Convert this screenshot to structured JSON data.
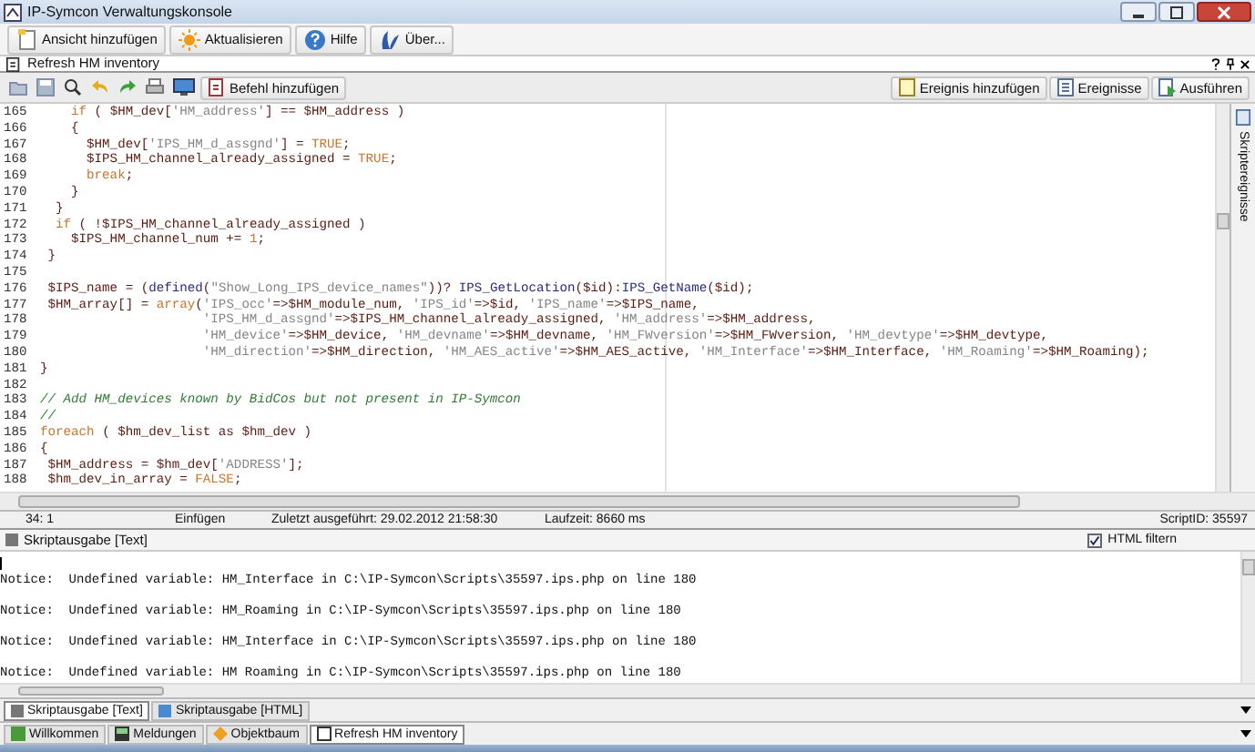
{
  "window": {
    "title": "IP-Symcon Verwaltungskonsole"
  },
  "main_toolbar": [
    {
      "label": "Ansicht hinzufügen"
    },
    {
      "label": "Aktualisieren"
    },
    {
      "label": "Hilfe"
    },
    {
      "label": "Über..."
    }
  ],
  "document": {
    "title": "Refresh HM inventory"
  },
  "script_toolbar": {
    "left_button": "Befehl hinzufügen",
    "right_buttons": [
      {
        "label": "Ereignis hinzufügen"
      },
      {
        "label": "Ereignisse"
      },
      {
        "label": "Ausführen"
      }
    ]
  },
  "editor": {
    "lines": [
      {
        "number": "165",
        "segments": [
          {
            "kind": "kw",
            "text": "    if"
          },
          {
            "kind": "plain",
            "text": " ( $HM_dev["
          },
          {
            "kind": "str",
            "text": "'HM_address'"
          },
          {
            "kind": "plain",
            "text": "] == $HM_address )"
          }
        ]
      },
      {
        "number": "166",
        "segments": [
          {
            "kind": "plain",
            "text": "    {"
          }
        ]
      },
      {
        "number": "167",
        "segments": [
          {
            "kind": "plain",
            "text": "      $HM_dev["
          },
          {
            "kind": "str",
            "text": "'IPS_HM_d_assgnd'"
          },
          {
            "kind": "plain",
            "text": "] = "
          },
          {
            "kind": "kw",
            "text": "TRUE"
          },
          {
            "kind": "plain",
            "text": ";"
          }
        ]
      },
      {
        "number": "168",
        "segments": [
          {
            "kind": "plain",
            "text": "      $IPS_HM_channel_already_assigned = "
          },
          {
            "kind": "kw",
            "text": "TRUE"
          },
          {
            "kind": "plain",
            "text": ";"
          }
        ]
      },
      {
        "number": "169",
        "segments": [
          {
            "kind": "kw",
            "text": "      break"
          },
          {
            "kind": "plain",
            "text": ";"
          }
        ]
      },
      {
        "number": "170",
        "segments": [
          {
            "kind": "plain",
            "text": "    }"
          }
        ]
      },
      {
        "number": "171",
        "segments": [
          {
            "kind": "plain",
            "text": "  }"
          }
        ]
      },
      {
        "number": "172",
        "segments": [
          {
            "kind": "kw",
            "text": "  if"
          },
          {
            "kind": "plain",
            "text": " ( !$IPS_HM_channel_already_assigned )"
          }
        ]
      },
      {
        "number": "173",
        "segments": [
          {
            "kind": "plain",
            "text": "    $IPS_HM_channel_num += "
          },
          {
            "kind": "kw",
            "text": "1"
          },
          {
            "kind": "plain",
            "text": ";"
          }
        ]
      },
      {
        "number": "174",
        "segments": [
          {
            "kind": "plain",
            "text": " }"
          }
        ]
      },
      {
        "number": "175"
      },
      {
        "number": "176",
        "segments": [
          {
            "kind": "plain",
            "text": " $IPS_name = ("
          },
          {
            "kind": "fn",
            "text": "defined"
          },
          {
            "kind": "plain",
            "text": "("
          },
          {
            "kind": "str",
            "text": "\"Show_Long_IPS_device_names\""
          },
          {
            "kind": "plain",
            "text": "))? "
          },
          {
            "kind": "fn",
            "text": "IPS_GetLocation"
          },
          {
            "kind": "plain",
            "text": "($id):"
          },
          {
            "kind": "fn",
            "text": "IPS_GetName"
          },
          {
            "kind": "plain",
            "text": "($id);"
          }
        ]
      },
      {
        "number": "177",
        "segments": [
          {
            "kind": "plain",
            "text": " $HM_array[] = "
          },
          {
            "kind": "kw",
            "text": "array"
          },
          {
            "kind": "plain",
            "text": "("
          },
          {
            "kind": "str",
            "text": "'IPS_occ'"
          },
          {
            "kind": "plain",
            "text": "=>$HM_module_num, "
          },
          {
            "kind": "str",
            "text": "'IPS_id'"
          },
          {
            "kind": "plain",
            "text": "=>$id, "
          },
          {
            "kind": "str",
            "text": "'IPS_name'"
          },
          {
            "kind": "plain",
            "text": "=>$IPS_name,"
          }
        ]
      },
      {
        "number": "178",
        "segments": [
          {
            "kind": "str",
            "text": "                     'IPS_HM_d_assgnd'"
          },
          {
            "kind": "plain",
            "text": "=>$IPS_HM_channel_already_assigned, "
          },
          {
            "kind": "str",
            "text": "'HM_address'"
          },
          {
            "kind": "plain",
            "text": "=>$HM_address,"
          }
        ]
      },
      {
        "number": "179",
        "segments": [
          {
            "kind": "str",
            "text": "                     'HM_device'"
          },
          {
            "kind": "plain",
            "text": "=>$HM_device, "
          },
          {
            "kind": "str",
            "text": "'HM_devname'"
          },
          {
            "kind": "plain",
            "text": "=>$HM_devname, "
          },
          {
            "kind": "str",
            "text": "'HM_FWversion'"
          },
          {
            "kind": "plain",
            "text": "=>$HM_FWversion, "
          },
          {
            "kind": "str",
            "text": "'HM_devtype'"
          },
          {
            "kind": "plain",
            "text": "=>$HM_devtype,"
          }
        ]
      },
      {
        "number": "180",
        "segments": [
          {
            "kind": "str",
            "text": "                     'HM_direction'"
          },
          {
            "kind": "plain",
            "text": "=>$HM_direction, "
          },
          {
            "kind": "str",
            "text": "'HM_AES_active'"
          },
          {
            "kind": "plain",
            "text": "=>$HM_AES_active, "
          },
          {
            "kind": "str",
            "text": "'HM_Interface'"
          },
          {
            "kind": "plain",
            "text": "=>$HM_Interface, "
          },
          {
            "kind": "str",
            "text": "'HM_Roaming'"
          },
          {
            "kind": "plain",
            "text": "=>$HM_Roaming);"
          }
        ]
      },
      {
        "number": "181",
        "segments": [
          {
            "kind": "plain",
            "text": "}"
          }
        ]
      },
      {
        "number": "182"
      },
      {
        "number": "183",
        "segments": [
          {
            "kind": "comment",
            "text": "// Add HM_devices known by BidCos but not present in IP-Symcon"
          }
        ]
      },
      {
        "number": "184",
        "segments": [
          {
            "kind": "comment",
            "text": "//"
          }
        ]
      },
      {
        "number": "185",
        "segments": [
          {
            "kind": "kw",
            "text": "foreach"
          },
          {
            "kind": "plain",
            "text": " ( $hm_dev_list as $hm_dev )"
          }
        ]
      },
      {
        "number": "186",
        "segments": [
          {
            "kind": "plain",
            "text": "{"
          }
        ]
      },
      {
        "number": "187",
        "segments": [
          {
            "kind": "plain",
            "text": " $HM_address = $hm_dev["
          },
          {
            "kind": "str",
            "text": "'ADDRESS'"
          },
          {
            "kind": "plain",
            "text": "];"
          }
        ]
      },
      {
        "number": "188",
        "segments": [
          {
            "kind": "plain",
            "text": " $hm_dev_in_array = "
          },
          {
            "kind": "kw",
            "text": "FALSE"
          },
          {
            "kind": "plain",
            "text": ";"
          }
        ]
      }
    ]
  },
  "side_panel": {
    "title": "Skriptereignisse"
  },
  "status_bar": {
    "position": "34: 1",
    "mode": "Einfügen",
    "last_run": "Zuletzt ausgeführt: 29.02.2012 21:58:30",
    "runtime": "Laufzeit: 8660 ms",
    "script_id": "ScriptID: 35597"
  },
  "output_panel": {
    "title": "Skriptausgabe [Text]",
    "html_filter": {
      "label": "HTML filtern",
      "checked": true
    },
    "lines": [
      "Notice:  Undefined variable: HM_Interface in C:\\IP-Symcon\\Scripts\\35597.ips.php on line 180",
      "Notice:  Undefined variable: HM_Roaming in C:\\IP-Symcon\\Scripts\\35597.ips.php on line 180",
      "Notice:  Undefined variable: HM_Interface in C:\\IP-Symcon\\Scripts\\35597.ips.php on line 180",
      "Notice:  Undefined variable: HM Roaming in C:\\IP-Symcon\\Scripts\\35597.ips.php on line 180"
    ]
  },
  "output_tabs": [
    {
      "label": "Skriptausgabe [Text]",
      "selected": true
    },
    {
      "label": "Skriptausgabe [HTML]",
      "selected": false
    }
  ],
  "bottom_tabs": [
    {
      "label": "Willkommen",
      "selected": false
    },
    {
      "label": "Meldungen",
      "selected": false
    },
    {
      "label": "Objektbaum",
      "selected": false
    },
    {
      "label": "Refresh HM inventory",
      "selected": true
    }
  ]
}
